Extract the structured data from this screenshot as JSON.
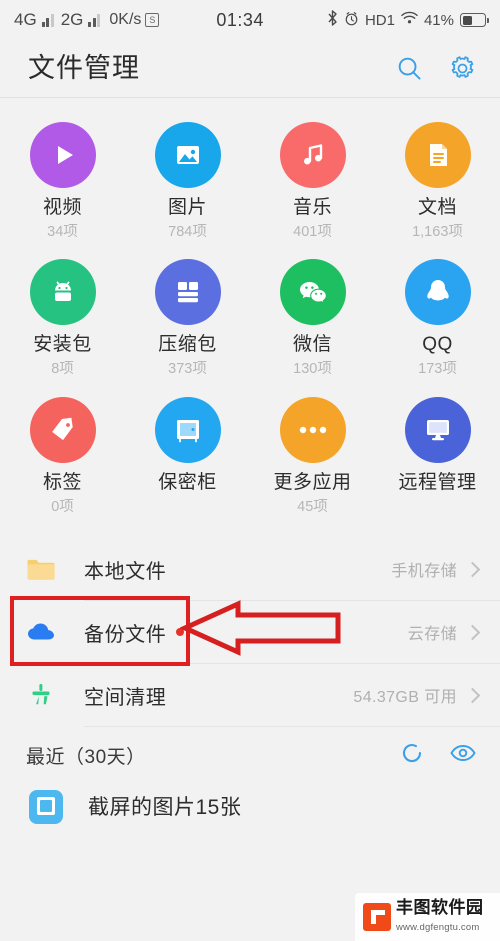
{
  "statusbar": {
    "sim1_net": "4G",
    "sim2_net": "2G",
    "sim_badge": "S",
    "netspeed": "0K/s",
    "time": "01:34",
    "bluetooth_icon": "bluetooth-icon",
    "alarm_icon": "alarm-icon",
    "hd_label": "HD1",
    "wifi_icon": "wifi-icon",
    "battery_text": "41%"
  },
  "header": {
    "title": "文件管理",
    "search_icon": "search-icon",
    "settings_icon": "gear-icon"
  },
  "categories": [
    {
      "label": "视频",
      "count": "34项",
      "icon": "play-icon",
      "color": "#b25ae8",
      "key": "video"
    },
    {
      "label": "图片",
      "count": "784项",
      "icon": "image-icon",
      "color": "#19a7ec",
      "key": "images"
    },
    {
      "label": "音乐",
      "count": "401项",
      "icon": "music-icon",
      "color": "#f96a6a",
      "key": "music"
    },
    {
      "label": "文档",
      "count": "1,163项",
      "icon": "document-icon",
      "color": "#f5a42a",
      "key": "documents"
    },
    {
      "label": "安装包",
      "count": "8项",
      "icon": "android-icon",
      "color": "#26c281",
      "key": "apk"
    },
    {
      "label": "压缩包",
      "count": "373项",
      "icon": "archive-icon",
      "color": "#5b6fe0",
      "key": "archive"
    },
    {
      "label": "微信",
      "count": "130项",
      "icon": "wechat-icon",
      "color": "#1dbf60",
      "key": "wechat"
    },
    {
      "label": "QQ",
      "count": "173项",
      "icon": "qq-icon",
      "color": "#2aa3f0",
      "key": "qq"
    },
    {
      "label": "标签",
      "count": "0项",
      "icon": "tag-icon",
      "color": "#f5635f",
      "key": "tags"
    },
    {
      "label": "保密柜",
      "count": "",
      "icon": "safe-icon",
      "color": "#22a7f0",
      "key": "safe"
    },
    {
      "label": "更多应用",
      "count": "45项",
      "icon": "more-dots-icon",
      "color": "#f5a42a",
      "key": "more-apps"
    },
    {
      "label": "远程管理",
      "count": "",
      "icon": "monitor-icon",
      "color": "#4a63d8",
      "key": "remote"
    }
  ],
  "list_rows": [
    {
      "label": "本地文件",
      "value": "手机存储",
      "icon": "folder-icon",
      "badge": false,
      "key": "local-files"
    },
    {
      "label": "备份文件",
      "value": "云存储",
      "icon": "cloud-icon",
      "badge": true,
      "key": "backup-files"
    },
    {
      "label": "空间清理",
      "value": "54.37GB 可用",
      "icon": "broom-icon",
      "badge": false,
      "key": "storage-cleanup"
    }
  ],
  "recent": {
    "title": "最近（30天）",
    "refresh_icon": "refresh-icon",
    "eye_icon": "eye-icon",
    "item_label": "截屏的图片15张",
    "item_icon": "screenshot-folder-icon"
  },
  "annotation": {
    "accent_color": "#e02020",
    "highlight_target": "本地文件",
    "shape": "arrow-pointing-left"
  },
  "watermark": {
    "name": "丰图软件园",
    "url": "www.dgfengtu.com"
  }
}
